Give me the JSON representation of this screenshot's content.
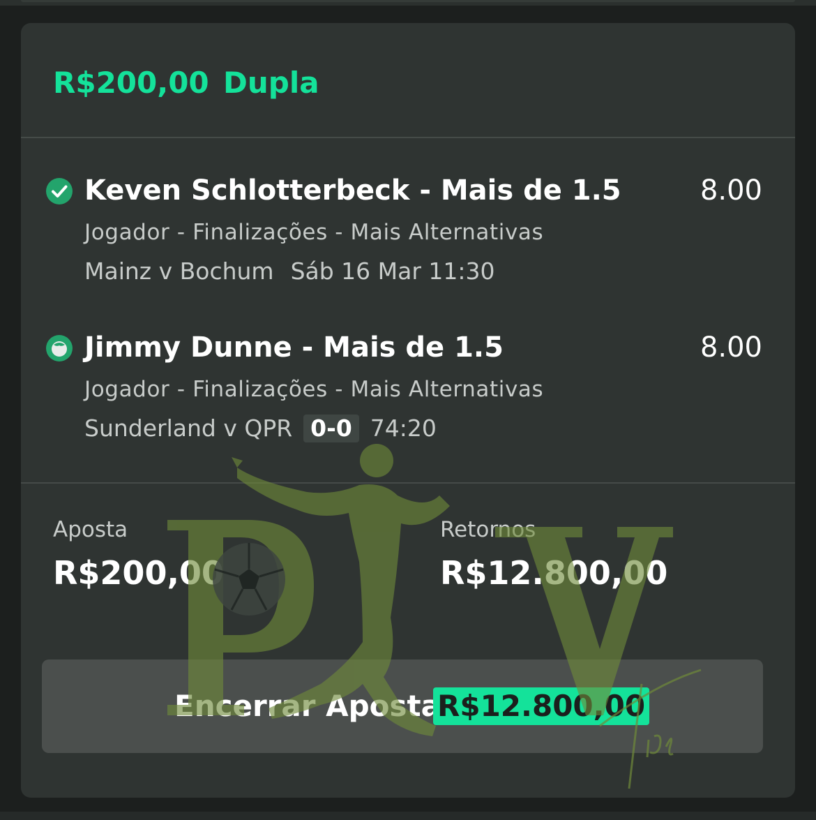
{
  "bet": {
    "amount": "R$200,00",
    "type": "Dupla"
  },
  "selections": [
    {
      "status": "won",
      "status_icon": "check-circle-icon",
      "name": "Keven Schlotterbeck - Mais de 1.5",
      "odds": "8.00",
      "market": "Jogador - Finalizações - Mais Alternativas",
      "event": "Mainz v Bochum",
      "datetime": "Sáb 16 Mar 11:30"
    },
    {
      "status": "live",
      "status_icon": "live-ball-icon",
      "name": "Jimmy Dunne - Mais de 1.5",
      "odds": "8.00",
      "market": "Jogador - Finalizações - Mais Alternativas",
      "event": "Sunderland v QPR",
      "score": "0-0",
      "clock": "74:20"
    }
  ],
  "summary": {
    "stake_label": "Aposta",
    "stake_value": "R$200,00",
    "returns_label": "Retornos",
    "returns_value": "R$12.800,00"
  },
  "cashout": {
    "label": "Encerrar Aposta",
    "amount": "R$12.800,00"
  },
  "watermark": {
    "text": "PV",
    "script": "Tips"
  },
  "colors": {
    "accent": "#14e29a",
    "card": "#2f3432",
    "background": "#1c1f1e",
    "button": "#4b4f4d",
    "watermark": "#6f8a3a"
  }
}
